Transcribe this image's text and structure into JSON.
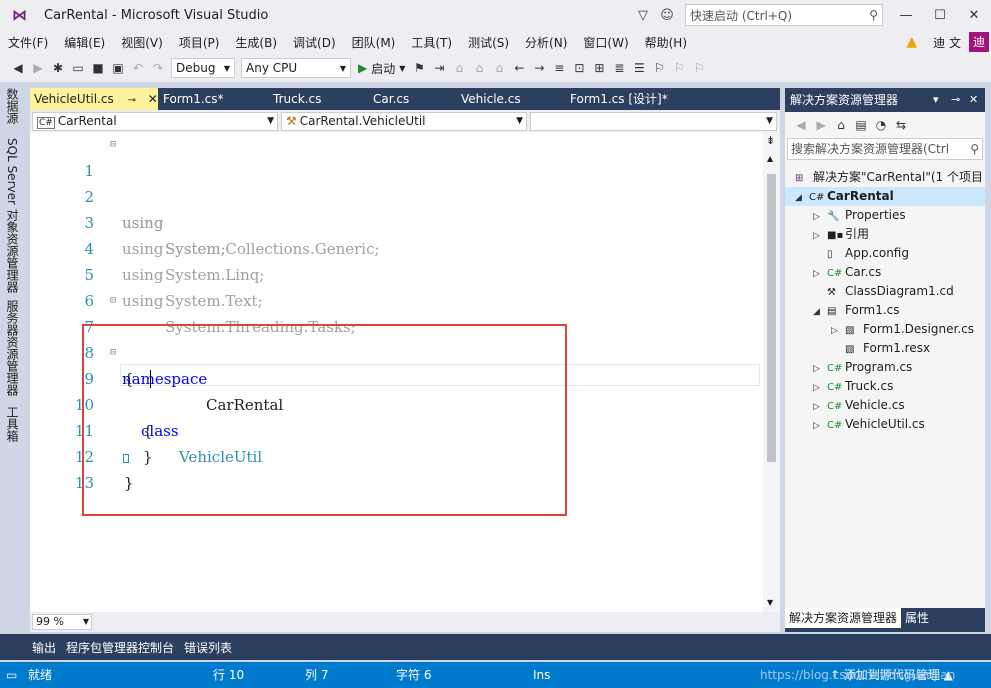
{
  "window": {
    "title": "CarRental - Microsoft Visual Studio",
    "quick_launch_placeholder": "快速启动 (Ctrl+Q)",
    "user": "迪 文",
    "avatar": "迪"
  },
  "menu": [
    "文件(F)",
    "编辑(E)",
    "视图(V)",
    "项目(P)",
    "生成(B)",
    "调试(D)",
    "团队(M)",
    "工具(T)",
    "测试(S)",
    "分析(N)",
    "窗口(W)",
    "帮助(H)"
  ],
  "toolbar": {
    "config": "Debug",
    "platform": "Any CPU",
    "start_label": "启动"
  },
  "left_tabs": [
    "数据源",
    "SQL Server 对象资源管理器",
    "服务器资源管理器",
    "工具箱"
  ],
  "doc_tabs": [
    "VehicleUtil.cs",
    "Form1.cs*",
    "Truck.cs",
    "Car.cs",
    "Vehicle.cs",
    "Form1.cs [设计]*"
  ],
  "nav": {
    "project": "CarRental",
    "type": "CarRental.VehicleUtil",
    "member": ""
  },
  "code": {
    "line_numbers": [
      "1",
      "2",
      "3",
      "4",
      "5",
      "6",
      "7",
      "8",
      "9",
      "10",
      "11",
      "12",
      "13"
    ],
    "using_kw": "using",
    "usings": [
      "System;",
      "System.Collections.Generic;",
      "System.Linq;",
      "System.Text;",
      "System.Threading.Tasks;"
    ],
    "namespace_kw": "namespace",
    "namespace_name": "CarRental",
    "open_brace": "{",
    "close_brace": "}",
    "class_kw": "class",
    "class_name": "VehicleUtil"
  },
  "zoom": "99 %",
  "solution_explorer": {
    "title": "解决方案资源管理器",
    "search_placeholder": "搜索解决方案资源管理器(Ctrl",
    "solution": "解决方案\"CarRental\"(1 个项目",
    "project": "CarRental",
    "items": [
      "Properties",
      "引用",
      "App.config",
      "Car.cs",
      "ClassDiagram1.cd",
      "Form1.cs",
      "Form1.Designer.cs",
      "Form1.resx",
      "Program.cs",
      "Truck.cs",
      "Vehicle.cs",
      "VehicleUtil.cs"
    ],
    "bottom_tabs": [
      "解决方案资源管理器",
      "属性"
    ]
  },
  "output_tabs": [
    "输出",
    "程序包管理器控制台",
    "错误列表"
  ],
  "status": {
    "ready": "就绪",
    "row": "行 10",
    "col": "列 7",
    "char": "字符 6",
    "ins": "Ins",
    "add_source": "↑ 添加到源代码管理 ▲"
  },
  "watermark": "https://blog.csdn.net/dnguanjian",
  "colors": {
    "keyword": "#0000ff",
    "type": "#2b91af",
    "active_tab": "#fff29d",
    "status_bar": "#007acc",
    "highlight_box": "#e04040"
  }
}
